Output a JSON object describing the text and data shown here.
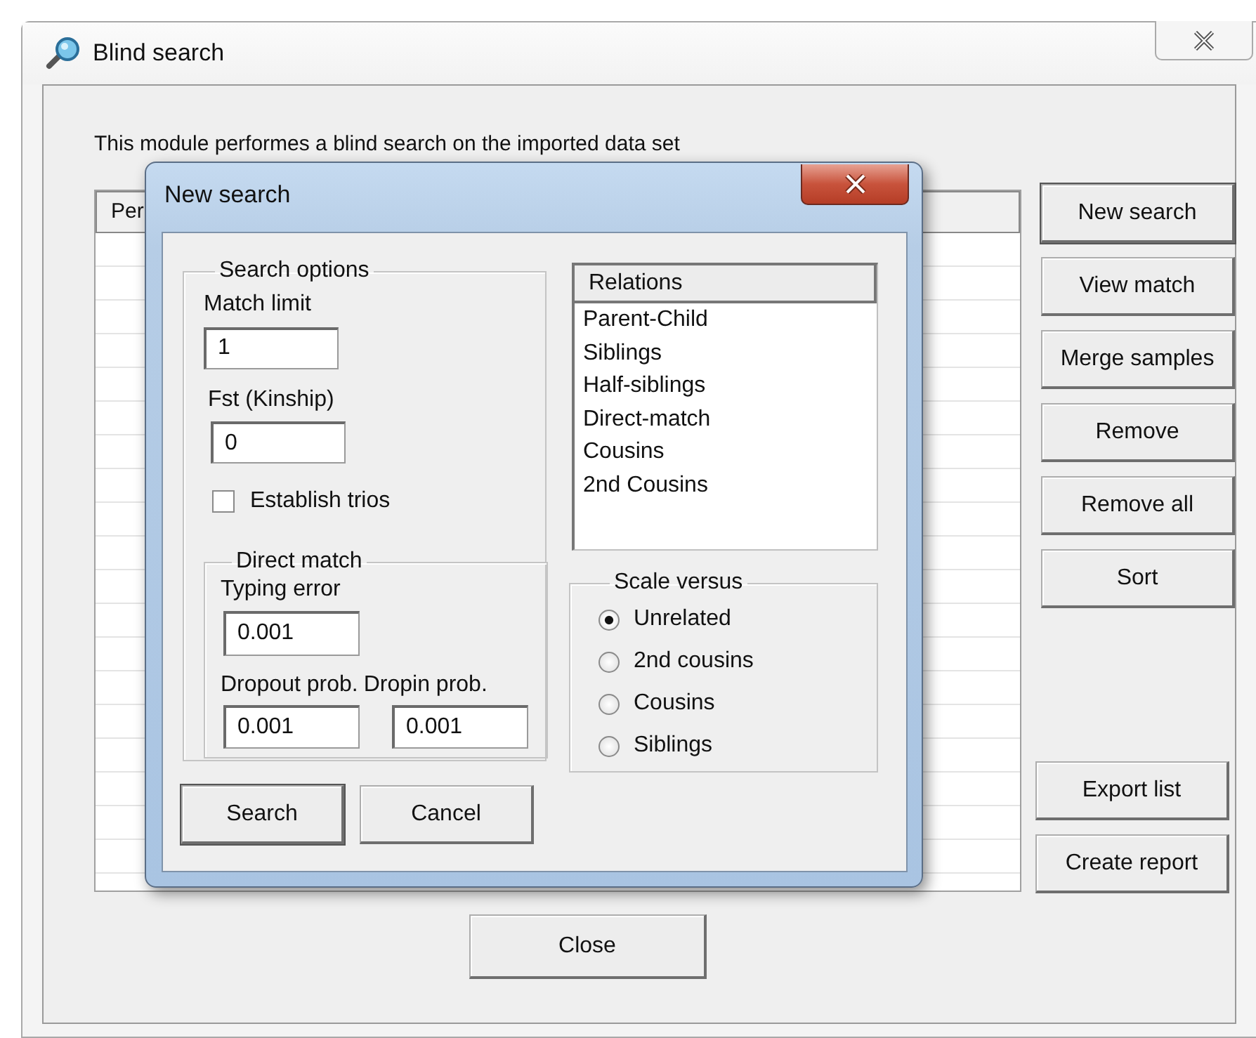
{
  "window": {
    "title": "Blind search"
  },
  "description": "This module performes a blind search on the imported data set",
  "table": {
    "columns": [
      "Per"
    ]
  },
  "side_buttons": [
    {
      "label": "New search",
      "default": true
    },
    {
      "label": "View match",
      "default": false
    },
    {
      "label": "Merge samples",
      "default": false
    },
    {
      "label": "Remove",
      "default": false
    },
    {
      "label": "Remove all",
      "default": false
    },
    {
      "label": "Sort",
      "default": false
    }
  ],
  "bottom_buttons": [
    "Export list",
    "Create report"
  ],
  "close_button": "Close",
  "dialog": {
    "title": "New search",
    "search_options": {
      "legend": "Search options",
      "match_limit": {
        "label": "Match limit",
        "value": "1"
      },
      "fst": {
        "label": "Fst (Kinship)",
        "value": "0"
      },
      "establish_trios": {
        "label": "Establish trios",
        "checked": false
      },
      "direct_match": {
        "legend": "Direct match",
        "typing_error": {
          "label": "Typing error",
          "value": "0.001"
        },
        "dropout": {
          "label": "Dropout prob.",
          "value": "0.001"
        },
        "dropin": {
          "label": "Dropin prob.",
          "value": "0.001"
        }
      }
    },
    "relations": {
      "header": "Relations",
      "items": [
        "Parent-Child",
        "Siblings",
        "Half-siblings",
        "Direct-match",
        "Cousins",
        "2nd Cousins"
      ]
    },
    "scale_versus": {
      "legend": "Scale versus",
      "options": [
        {
          "label": "Unrelated",
          "selected": true
        },
        {
          "label": "2nd cousins",
          "selected": false
        },
        {
          "label": "Cousins",
          "selected": false
        },
        {
          "label": "Siblings",
          "selected": false
        }
      ]
    },
    "buttons": [
      {
        "label": "Search",
        "default": true
      },
      {
        "label": "Cancel",
        "default": false
      }
    ]
  }
}
